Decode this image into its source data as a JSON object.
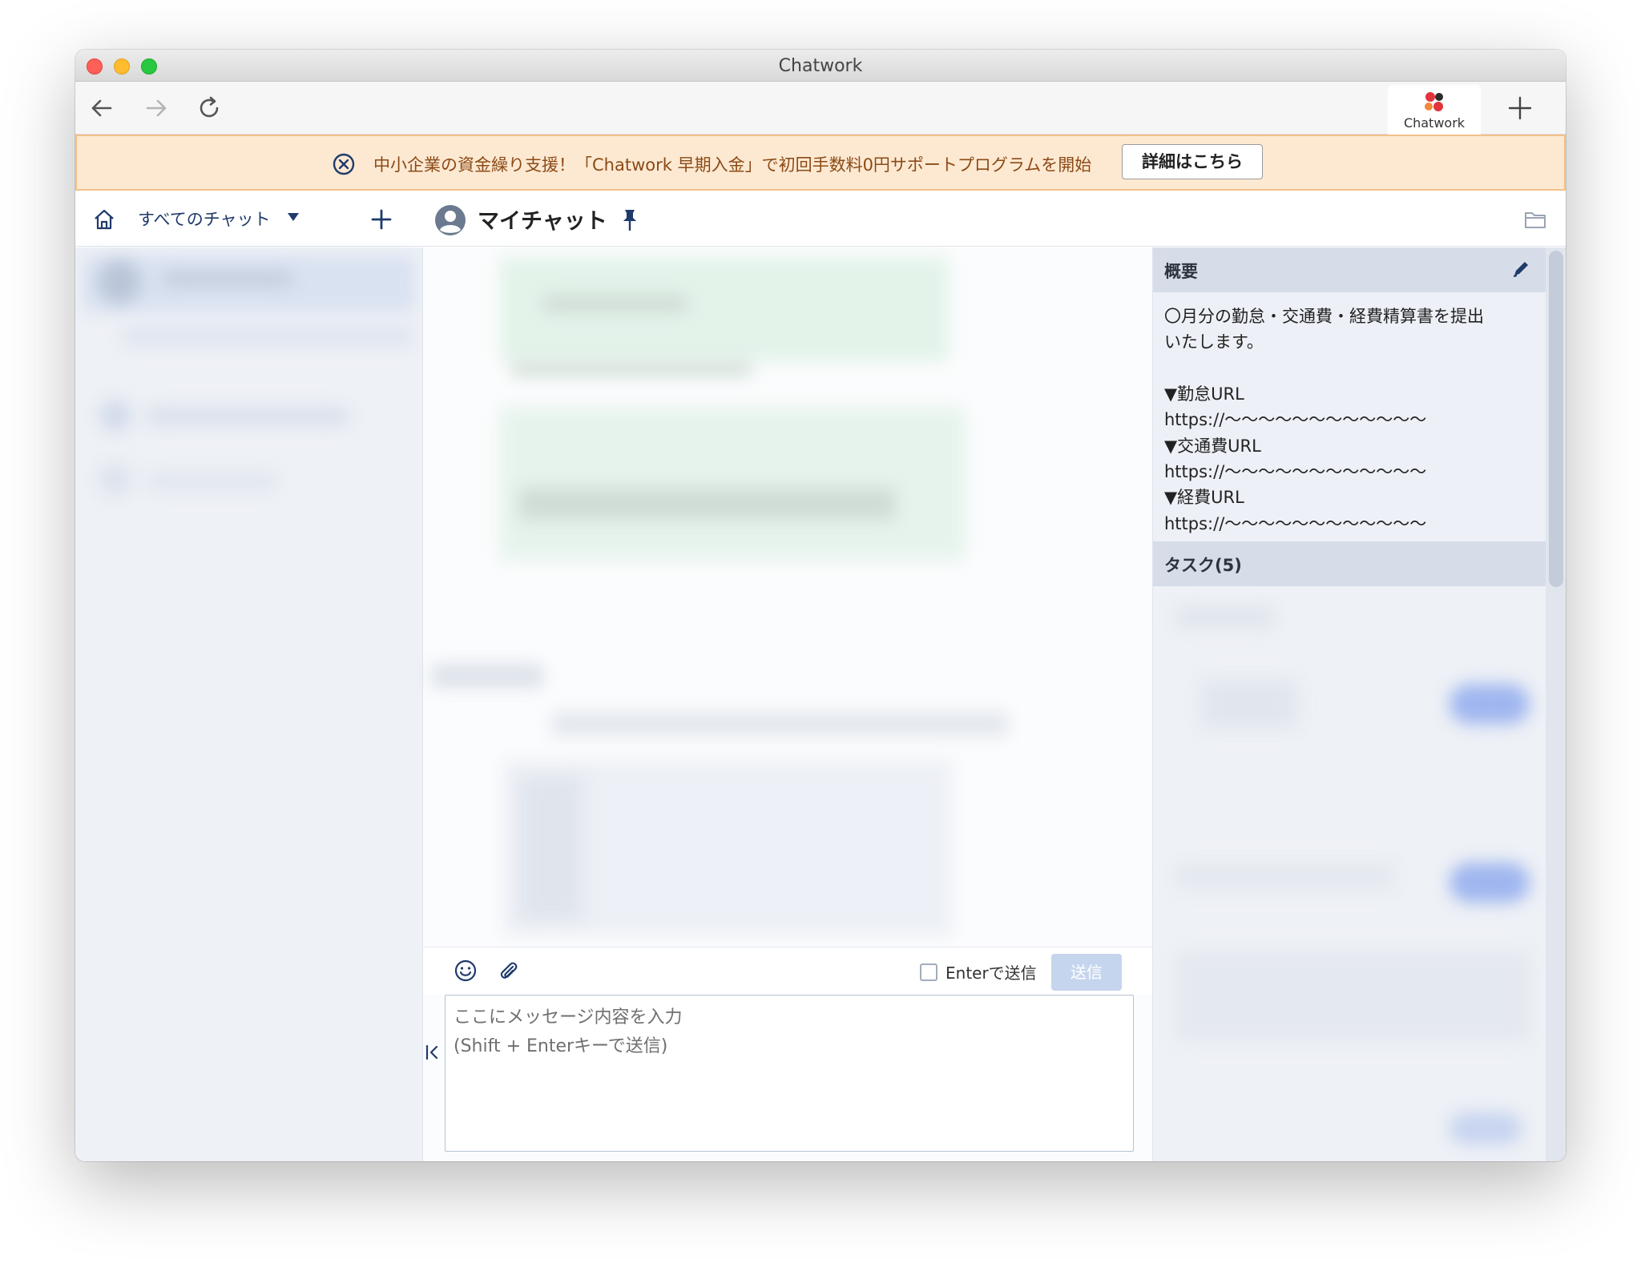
{
  "window": {
    "title": "Chatwork"
  },
  "browser": {
    "app_tab_label": "Chatwork"
  },
  "banner": {
    "text": "中小企業の資金繰り支援！「Chatwork 早期入金」で初回手数料0円サポートプログラムを開始",
    "button_label": "詳細はこちら"
  },
  "header": {
    "chat_filter": "すべてのチャット",
    "room_name": "マイチャット"
  },
  "composer": {
    "enter_to_send_label": "Enterで送信",
    "send_label": "送信",
    "placeholder": "ここにメッセージ内容を入力\n(Shift + Enterキーで送信)"
  },
  "room_panel": {
    "summary_title": "概要",
    "summary_lines": [
      "〇月分の勤怠・交通費・経費精算書を提出",
      "いたします。",
      "",
      "▼勤怠URL",
      "https://〜〜〜〜〜〜〜〜〜〜〜〜",
      "▼交通費URL",
      "https://〜〜〜〜〜〜〜〜〜〜〜〜",
      "▼経費URL",
      "https://〜〜〜〜〜〜〜〜〜〜〜〜"
    ],
    "task_title": "タスク(5)"
  },
  "colors": {
    "brand_navy": "#1f3a6b",
    "banner_bg": "#fde9d2",
    "banner_border": "#f3c188",
    "send_disabled": "#c6d5ee",
    "panel_header": "#d7dde8"
  },
  "icons": {
    "back": "back-arrow-icon",
    "forward": "forward-arrow-icon",
    "reload": "reload-icon",
    "new_tab": "plus-icon",
    "banner_close": "close-circle-icon",
    "home": "home-icon",
    "add_room": "plus-icon",
    "avatar": "user-avatar-icon",
    "pin": "pin-icon",
    "folder": "folder-icon",
    "emoji": "emoji-icon",
    "attach": "paperclip-icon",
    "edit": "pencil-icon",
    "collapse": "collapse-left-icon"
  }
}
